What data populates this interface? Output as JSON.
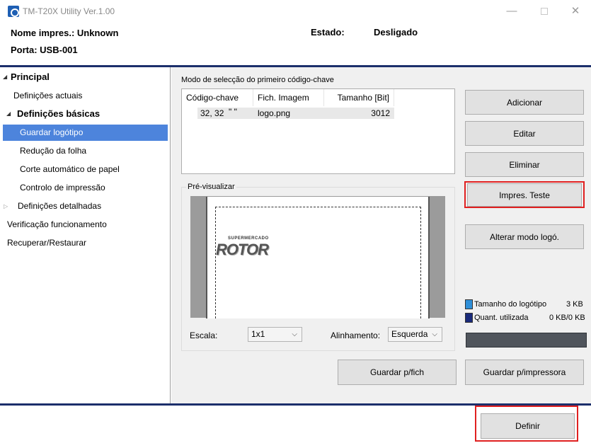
{
  "window": {
    "title": "TM-T20X Utility Ver.1.00",
    "minimize": "—",
    "close": "✕"
  },
  "header": {
    "printer_name": "Nome impres.: Unknown",
    "port": "Porta: USB-001",
    "status_label": "Estado:",
    "status_value": "Desligado"
  },
  "sidebar": {
    "items": [
      {
        "label": "Principal"
      },
      {
        "label": "Definições actuais"
      },
      {
        "label": "Definições básicas"
      },
      {
        "label": "Guardar logótipo",
        "selected": true
      },
      {
        "label": "Redução da folha"
      },
      {
        "label": "Corte automático de papel"
      },
      {
        "label": "Controlo de impressão"
      },
      {
        "label": "Definições detalhadas"
      },
      {
        "label": "Verificação funcionamento"
      },
      {
        "label": "Recuperar/Restaurar"
      }
    ]
  },
  "main": {
    "list_caption": "Modo de selecção do primeiro código-chave",
    "columns": [
      "Código-chave",
      "Fich. Imagem",
      "Tamanho [Bit]"
    ],
    "rows": [
      {
        "key": "32, 32",
        "key_chars": "\" \"",
        "file": "logo.png",
        "size": "3012"
      }
    ],
    "buttons": {
      "add": "Adicionar",
      "edit": "Editar",
      "delete": "Eliminar",
      "test_print": "Impres. Teste",
      "change_mode": "Alterar modo logó.",
      "save_file": "Guardar p/fich",
      "save_printer": "Guardar p/impressora"
    },
    "preview_caption": "Pré-visualizar",
    "logo_text": "ROTOR",
    "logo_subtext": "SUPERMERCADO",
    "scale_label": "Escala:",
    "scale_value": "1x1",
    "align_label": "Alinhamento:",
    "align_value": "Esquerda",
    "legend": [
      {
        "label": "Tamanho do logótipo",
        "value": "3 KB",
        "color": "#2f8fd8"
      },
      {
        "label": "Quant. utilizada",
        "value": "0 KB/0 KB",
        "color": "#1a2a7a"
      }
    ]
  },
  "footer": {
    "define": "Definir"
  },
  "colors": {
    "accent": "#4d84dc",
    "separator": "#1c2f6b",
    "highlight": "#e02020"
  }
}
